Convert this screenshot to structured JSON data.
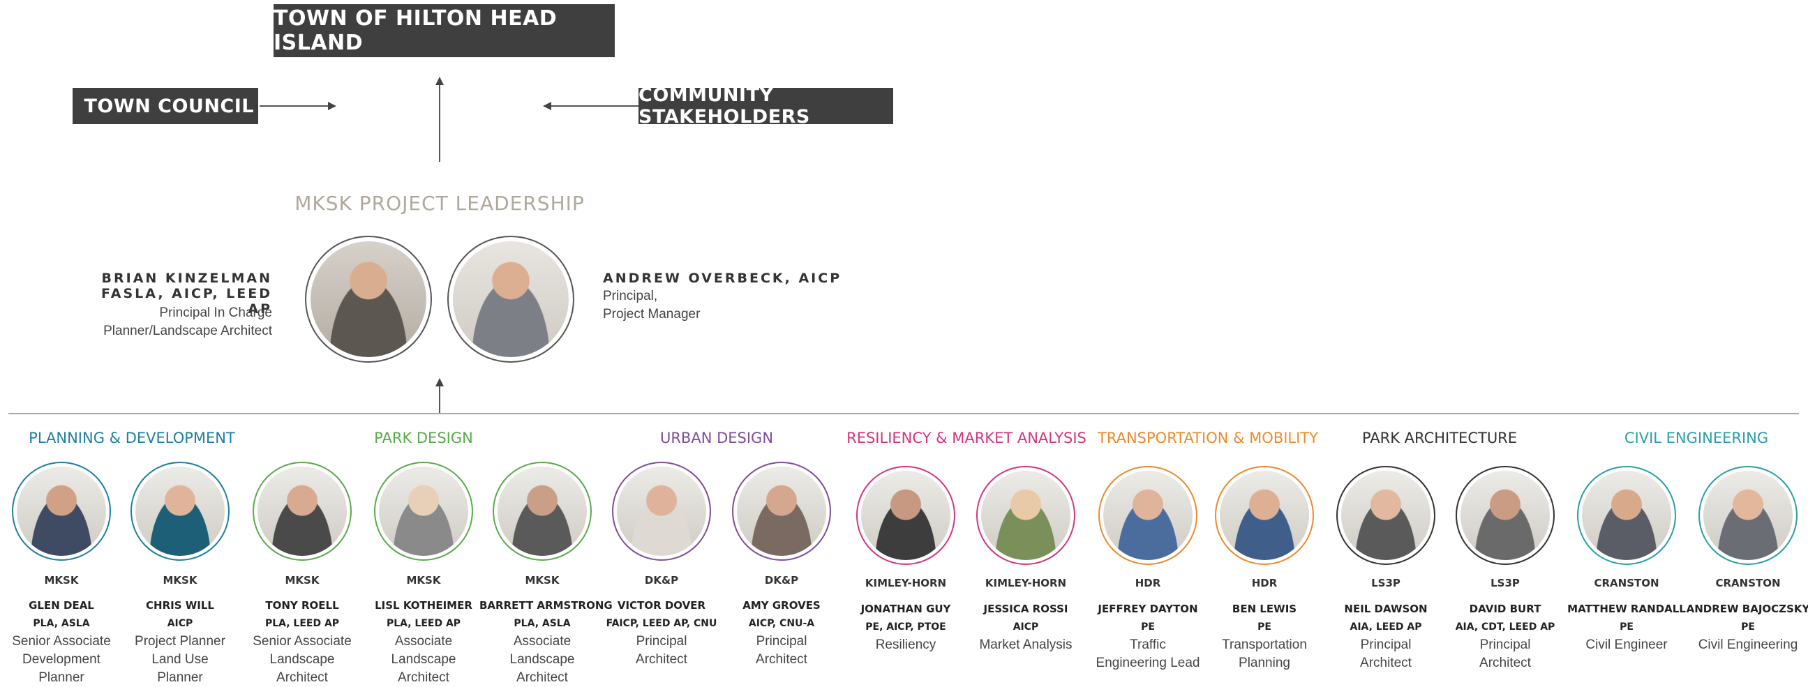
{
  "top": {
    "town": "TOWN OF HILTON HEAD ISLAND",
    "council": "TOWN COUNCIL",
    "stakeholders": "COMMUNITY STAKEHOLDERS"
  },
  "leadership": {
    "title": "MKSK PROJECT LEADERSHIP",
    "left": {
      "name1": "BRIAN KINZELMAN",
      "name2": "FASLA, AICP, LEED AP",
      "role1": "Principal In Charge",
      "role2": "Planner/Landscape Architect"
    },
    "right": {
      "name": "ANDREW OVERBECK, AICP",
      "role1": "Principal,",
      "role2": "Project Manager"
    }
  },
  "colors": {
    "planning": "#1e7fa0",
    "park_design": "#5aab4a",
    "urban": "#7e4e9c",
    "resiliency": "#d4357f",
    "transport": "#ee8a2c",
    "park_arch": "#333333",
    "civil": "#2a9fa6"
  },
  "categories": [
    {
      "label": "PLANNING & DEVELOPMENT",
      "color": "#1e7fa0"
    },
    {
      "label": "PARK DESIGN",
      "color": "#5aab4a"
    },
    {
      "label": "URBAN DESIGN",
      "color": "#7e4e9c"
    },
    {
      "label": "RESILIENCY & MARKET ANALYSIS",
      "color": "#d4357f"
    },
    {
      "label": "TRANSPORTATION & MOBILITY",
      "color": "#ee8a2c"
    },
    {
      "label": "PARK ARCHITECTURE",
      "color": "#333333"
    },
    {
      "label": "CIVIL ENGINEERING",
      "color": "#2a9fa6"
    }
  ],
  "members": [
    {
      "firm": "MKSK",
      "name": "GLEN DEAL",
      "cred": "PLA, ASLA",
      "roles": [
        "Senior Associate",
        "Development",
        "Planner"
      ]
    },
    {
      "firm": "MKSK",
      "name": "CHRIS WILL",
      "cred": "AICP",
      "roles": [
        "Project Planner",
        "Land Use",
        "Planner"
      ]
    },
    {
      "firm": "MKSK",
      "name": "TONY ROELL",
      "cred": "PLA, LEED AP",
      "roles": [
        "Senior Associate",
        "Landscape",
        "Architect"
      ]
    },
    {
      "firm": "MKSK",
      "name": "LISL KOTHEIMER",
      "cred": "PLA, LEED AP",
      "roles": [
        "Associate",
        "Landscape",
        "Architect"
      ]
    },
    {
      "firm": "MKSK",
      "name": "BARRETT ARMSTRONG",
      "cred": "PLA, ASLA",
      "roles": [
        "Associate",
        "Landscape",
        "Architect"
      ]
    },
    {
      "firm": "DK&P",
      "name": "VICTOR DOVER",
      "cred": "FAICP, LEED AP, CNU",
      "roles": [
        "Principal",
        "Architect"
      ]
    },
    {
      "firm": "DK&P",
      "name": "AMY GROVES",
      "cred": "AICP, CNU-A",
      "roles": [
        "Principal",
        "Architect"
      ]
    },
    {
      "firm": "KIMLEY-HORN",
      "name": "JONATHAN GUY",
      "cred": "PE, AICP, PTOE",
      "roles": [
        "Resiliency"
      ]
    },
    {
      "firm": "KIMLEY-HORN",
      "name": "JESSICA ROSSI",
      "cred": "AICP",
      "roles": [
        "Market Analysis"
      ]
    },
    {
      "firm": "HDR",
      "name": "JEFFREY DAYTON",
      "cred": "PE",
      "roles": [
        "Traffic",
        "Engineering Lead"
      ]
    },
    {
      "firm": "HDR",
      "name": "BEN LEWIS",
      "cred": "PE",
      "roles": [
        "Transportation",
        "Planning"
      ]
    },
    {
      "firm": "LS3P",
      "name": "NEIL DAWSON",
      "cred": "AIA, LEED AP",
      "roles": [
        "Principal",
        "Architect"
      ]
    },
    {
      "firm": "LS3P",
      "name": "DAVID BURT",
      "cred": "AIA, CDT, LEED AP",
      "roles": [
        "Principal",
        "Architect"
      ]
    },
    {
      "firm": "CRANSTON",
      "name": "MATTHEW RANDALL",
      "cred": "PE",
      "roles": [
        "Civil Engineer"
      ]
    },
    {
      "firm": "CRANSTON",
      "name": "ANDREW BAJOCZSKY",
      "cred": "PE",
      "roles": [
        "Civil Engineering"
      ]
    }
  ]
}
